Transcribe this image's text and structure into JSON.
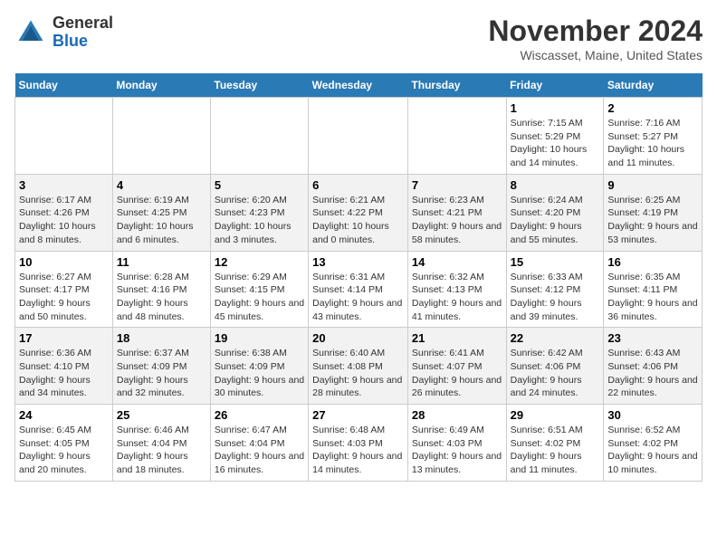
{
  "logo": {
    "general": "General",
    "blue": "Blue"
  },
  "title": "November 2024",
  "subtitle": "Wiscasset, Maine, United States",
  "days_of_week": [
    "Sunday",
    "Monday",
    "Tuesday",
    "Wednesday",
    "Thursday",
    "Friday",
    "Saturday"
  ],
  "weeks": [
    {
      "cells": [
        {
          "day": null,
          "info": null
        },
        {
          "day": null,
          "info": null
        },
        {
          "day": null,
          "info": null
        },
        {
          "day": null,
          "info": null
        },
        {
          "day": null,
          "info": null
        },
        {
          "day": "1",
          "info": "Sunrise: 7:15 AM\nSunset: 5:29 PM\nDaylight: 10 hours and 14 minutes."
        },
        {
          "day": "2",
          "info": "Sunrise: 7:16 AM\nSunset: 5:27 PM\nDaylight: 10 hours and 11 minutes."
        }
      ]
    },
    {
      "cells": [
        {
          "day": "3",
          "info": "Sunrise: 6:17 AM\nSunset: 4:26 PM\nDaylight: 10 hours and 8 minutes."
        },
        {
          "day": "4",
          "info": "Sunrise: 6:19 AM\nSunset: 4:25 PM\nDaylight: 10 hours and 6 minutes."
        },
        {
          "day": "5",
          "info": "Sunrise: 6:20 AM\nSunset: 4:23 PM\nDaylight: 10 hours and 3 minutes."
        },
        {
          "day": "6",
          "info": "Sunrise: 6:21 AM\nSunset: 4:22 PM\nDaylight: 10 hours and 0 minutes."
        },
        {
          "day": "7",
          "info": "Sunrise: 6:23 AM\nSunset: 4:21 PM\nDaylight: 9 hours and 58 minutes."
        },
        {
          "day": "8",
          "info": "Sunrise: 6:24 AM\nSunset: 4:20 PM\nDaylight: 9 hours and 55 minutes."
        },
        {
          "day": "9",
          "info": "Sunrise: 6:25 AM\nSunset: 4:19 PM\nDaylight: 9 hours and 53 minutes."
        }
      ]
    },
    {
      "cells": [
        {
          "day": "10",
          "info": "Sunrise: 6:27 AM\nSunset: 4:17 PM\nDaylight: 9 hours and 50 minutes."
        },
        {
          "day": "11",
          "info": "Sunrise: 6:28 AM\nSunset: 4:16 PM\nDaylight: 9 hours and 48 minutes."
        },
        {
          "day": "12",
          "info": "Sunrise: 6:29 AM\nSunset: 4:15 PM\nDaylight: 9 hours and 45 minutes."
        },
        {
          "day": "13",
          "info": "Sunrise: 6:31 AM\nSunset: 4:14 PM\nDaylight: 9 hours and 43 minutes."
        },
        {
          "day": "14",
          "info": "Sunrise: 6:32 AM\nSunset: 4:13 PM\nDaylight: 9 hours and 41 minutes."
        },
        {
          "day": "15",
          "info": "Sunrise: 6:33 AM\nSunset: 4:12 PM\nDaylight: 9 hours and 39 minutes."
        },
        {
          "day": "16",
          "info": "Sunrise: 6:35 AM\nSunset: 4:11 PM\nDaylight: 9 hours and 36 minutes."
        }
      ]
    },
    {
      "cells": [
        {
          "day": "17",
          "info": "Sunrise: 6:36 AM\nSunset: 4:10 PM\nDaylight: 9 hours and 34 minutes."
        },
        {
          "day": "18",
          "info": "Sunrise: 6:37 AM\nSunset: 4:09 PM\nDaylight: 9 hours and 32 minutes."
        },
        {
          "day": "19",
          "info": "Sunrise: 6:38 AM\nSunset: 4:09 PM\nDaylight: 9 hours and 30 minutes."
        },
        {
          "day": "20",
          "info": "Sunrise: 6:40 AM\nSunset: 4:08 PM\nDaylight: 9 hours and 28 minutes."
        },
        {
          "day": "21",
          "info": "Sunrise: 6:41 AM\nSunset: 4:07 PM\nDaylight: 9 hours and 26 minutes."
        },
        {
          "day": "22",
          "info": "Sunrise: 6:42 AM\nSunset: 4:06 PM\nDaylight: 9 hours and 24 minutes."
        },
        {
          "day": "23",
          "info": "Sunrise: 6:43 AM\nSunset: 4:06 PM\nDaylight: 9 hours and 22 minutes."
        }
      ]
    },
    {
      "cells": [
        {
          "day": "24",
          "info": "Sunrise: 6:45 AM\nSunset: 4:05 PM\nDaylight: 9 hours and 20 minutes."
        },
        {
          "day": "25",
          "info": "Sunrise: 6:46 AM\nSunset: 4:04 PM\nDaylight: 9 hours and 18 minutes."
        },
        {
          "day": "26",
          "info": "Sunrise: 6:47 AM\nSunset: 4:04 PM\nDaylight: 9 hours and 16 minutes."
        },
        {
          "day": "27",
          "info": "Sunrise: 6:48 AM\nSunset: 4:03 PM\nDaylight: 9 hours and 14 minutes."
        },
        {
          "day": "28",
          "info": "Sunrise: 6:49 AM\nSunset: 4:03 PM\nDaylight: 9 hours and 13 minutes."
        },
        {
          "day": "29",
          "info": "Sunrise: 6:51 AM\nSunset: 4:02 PM\nDaylight: 9 hours and 11 minutes."
        },
        {
          "day": "30",
          "info": "Sunrise: 6:52 AM\nSunset: 4:02 PM\nDaylight: 9 hours and 10 minutes."
        }
      ]
    }
  ]
}
